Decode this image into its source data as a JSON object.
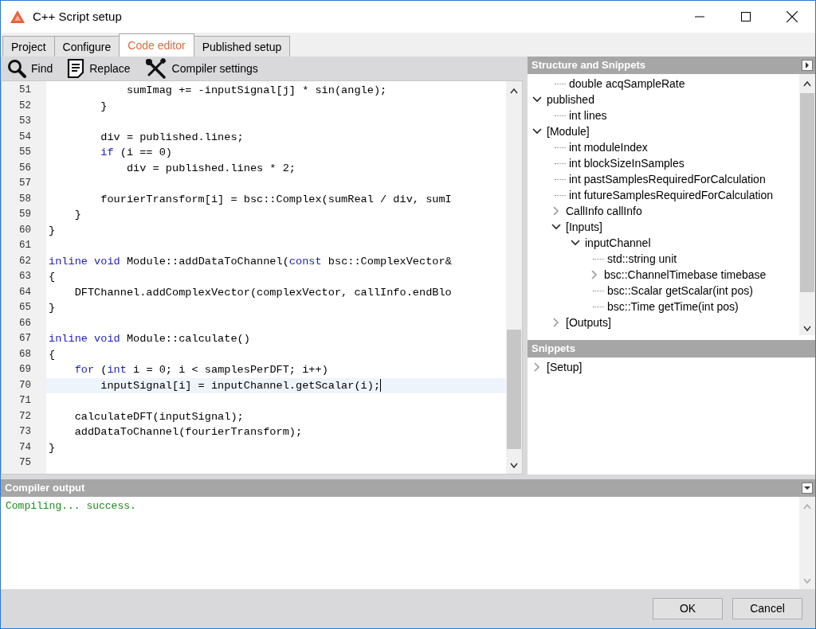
{
  "window": {
    "title": "C++ Script setup"
  },
  "tabs": [
    {
      "label": "Project",
      "selected": false
    },
    {
      "label": "Configure",
      "selected": false
    },
    {
      "label": "Code editor",
      "selected": true
    },
    {
      "label": "Published setup",
      "selected": false
    }
  ],
  "toolbar": [
    {
      "label": "Find",
      "kind": "search"
    },
    {
      "label": "Replace",
      "kind": "document"
    },
    {
      "label": "Compiler settings",
      "kind": "tools"
    }
  ],
  "editor": {
    "lines": [
      {
        "number": "51",
        "selected": false,
        "segments": [
          {
            "text": "            sumImag += -inputSignal[j] * sin(angle);",
            "keyword": false
          }
        ]
      },
      {
        "number": "52",
        "selected": false,
        "segments": [
          {
            "text": "        }",
            "keyword": false
          }
        ]
      },
      {
        "number": "53",
        "selected": false
      },
      {
        "number": "54",
        "selected": false,
        "segments": [
          {
            "text": "        div = published.lines;",
            "keyword": false
          }
        ]
      },
      {
        "number": "55",
        "selected": false,
        "segments": [
          {
            "text": "        if",
            "keyword": true
          },
          {
            "text": " (i == 0)",
            "keyword": false
          }
        ]
      },
      {
        "number": "56",
        "selected": false,
        "segments": [
          {
            "text": "            div = published.lines * 2;",
            "keyword": false
          }
        ]
      },
      {
        "number": "57",
        "selected": false
      },
      {
        "number": "58",
        "selected": false,
        "segments": [
          {
            "text": "        fourierTransform[i] = bsc::Complex(sumReal / div, sumI",
            "keyword": false
          }
        ]
      },
      {
        "number": "59",
        "selected": false,
        "segments": [
          {
            "text": "    }",
            "keyword": false
          }
        ]
      },
      {
        "number": "60",
        "selected": false,
        "segments": [
          {
            "text": "}",
            "keyword": false
          }
        ]
      },
      {
        "number": "61",
        "selected": false
      },
      {
        "number": "62",
        "selected": false,
        "segments": [
          {
            "text": "inline",
            "keyword": true
          },
          {
            "text": " void",
            "keyword": true
          },
          {
            "text": " Module::addDataToChannel(",
            "keyword": false
          },
          {
            "text": "const",
            "keyword": true
          },
          {
            "text": " bsc::ComplexVector&",
            "keyword": false
          }
        ]
      },
      {
        "number": "63",
        "selected": false,
        "segments": [
          {
            "text": "{",
            "keyword": false
          }
        ]
      },
      {
        "number": "64",
        "selected": false,
        "segments": [
          {
            "text": "    DFTChannel.addComplexVector(complexVector, callInfo.endBlo",
            "keyword": false
          }
        ]
      },
      {
        "number": "65",
        "selected": false,
        "segments": [
          {
            "text": "}",
            "keyword": false
          }
        ]
      },
      {
        "number": "66",
        "selected": false
      },
      {
        "number": "67",
        "selected": false,
        "segments": [
          {
            "text": "inline",
            "keyword": true
          },
          {
            "text": " void",
            "keyword": true
          },
          {
            "text": " Module::calculate()",
            "keyword": false
          }
        ]
      },
      {
        "number": "68",
        "selected": false,
        "segments": [
          {
            "text": "{",
            "keyword": false
          }
        ]
      },
      {
        "number": "69",
        "selected": false,
        "segments": [
          {
            "text": "    for",
            "keyword": true
          },
          {
            "text": " (",
            "keyword": false
          },
          {
            "text": "int",
            "keyword": true
          },
          {
            "text": " i = 0; i < samplesPerDFT; i++)",
            "keyword": false
          }
        ]
      },
      {
        "number": "70",
        "selected": true,
        "segments": [
          {
            "text": "        inputSignal[i] = inputChannel.getScalar(i);",
            "keyword": false
          }
        ]
      },
      {
        "number": "71",
        "selected": false
      },
      {
        "number": "72",
        "selected": false,
        "segments": [
          {
            "text": "    calculateDFT(inputSignal);",
            "keyword": false
          }
        ]
      },
      {
        "number": "73",
        "selected": false,
        "segments": [
          {
            "text": "    addDataToChannel(fourierTransform);",
            "keyword": false
          }
        ]
      },
      {
        "number": "74",
        "selected": false,
        "segments": [
          {
            "text": "}",
            "keyword": false
          }
        ]
      },
      {
        "number": "75",
        "selected": false
      }
    ]
  },
  "structure": {
    "title": "Structure and Snippets",
    "tree_continued": [
      {
        "label": "double acqSampleRate"
      }
    ],
    "tree": [
      {
        "label": "published",
        "expanded": true,
        "children": [
          {
            "label": "int lines"
          }
        ]
      },
      {
        "label": "[Module]",
        "expanded": true,
        "children": [
          {
            "label": "int moduleIndex"
          },
          {
            "label": "int blockSizeInSamples"
          },
          {
            "label": "int pastSamplesRequiredForCalculation"
          },
          {
            "label": "int futureSamplesRequiredForCalculation"
          },
          {
            "label": "CallInfo callInfo",
            "expanded": false
          },
          {
            "label": "[Inputs]",
            "expanded": true,
            "children": [
              {
                "label": "inputChannel",
                "expanded": true,
                "children": [
                  {
                    "label": "std::string unit"
                  },
                  {
                    "label": "bsc::ChannelTimebase timebase",
                    "expanded": false
                  },
                  {
                    "label": "bsc::Scalar getScalar(int pos)"
                  },
                  {
                    "label": "bsc::Time getTime(int pos)"
                  }
                ]
              }
            ]
          },
          {
            "label": "[Outputs]",
            "expanded": false
          }
        ]
      }
    ]
  },
  "snippets": {
    "title": "Snippets",
    "tree": [
      {
        "label": "[Setup]",
        "expanded": false
      }
    ]
  },
  "compiler_output": {
    "title": "Compiler output",
    "lines": [
      "Compiling... success."
    ]
  },
  "buttons": [
    "OK",
    "Cancel"
  ]
}
